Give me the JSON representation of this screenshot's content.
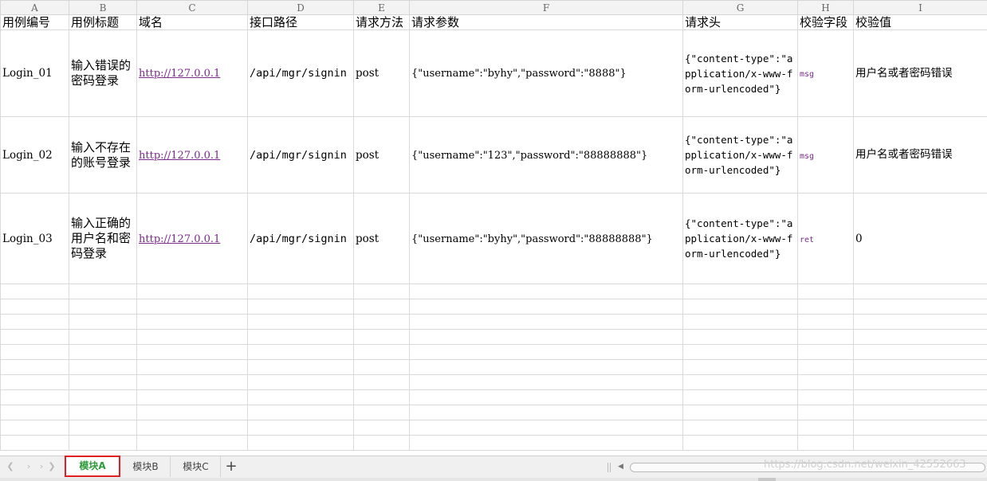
{
  "columns": [
    "A",
    "B",
    "C",
    "D",
    "E",
    "F",
    "G",
    "H",
    "I"
  ],
  "headers": [
    "用例编号",
    "用例标题",
    "域名",
    "接口路径",
    "请求方法",
    "请求参数",
    "请求头",
    "校验字段",
    "校验值"
  ],
  "rows": [
    {
      "id": "Login_01",
      "title": "输入错误的密码登录",
      "domain": "http://127.0.0.1",
      "path": "/api/mgr/signin",
      "method": "post",
      "params": "{\"username\":\"byhy\",\"password\":\"8888\"}",
      "headers": "{\"content-type\":\"application/x-www-form-urlencoded\"}",
      "field": "msg",
      "expected": "用户名或者密码错误"
    },
    {
      "id": "Login_02",
      "title": "输入不存在的账号登录",
      "domain": "http://127.0.0.1",
      "path": "/api/mgr/signin",
      "method": "post",
      "params": "{\"username\":\"123\",\"password\":\"88888888\"}",
      "headers": "{\"content-type\":\"application/x-www-form-urlencoded\"}",
      "field": "msg",
      "expected": "用户名或者密码错误"
    },
    {
      "id": "Login_03",
      "title": "输入正确的用户名和密码登录",
      "domain": "http://127.0.0.1",
      "path": "/api/mgr/signin",
      "method": "post",
      "params": "{\"username\":\"byhy\",\"password\":\"88888888\"}",
      "headers": "{\"content-type\":\"application/x-www-form-urlencoded\"}",
      "field": "ret",
      "expected": "0"
    }
  ],
  "sheet_tabs": {
    "active": "模块A",
    "tab_b": "模块B",
    "tab_c": "模块C",
    "add": "+"
  },
  "nav_icons": [
    "first-sheet-icon",
    "prev-sheet-icon",
    "next-sheet-icon",
    "last-sheet-icon"
  ],
  "watermark": "https://blog.csdn.net/weixin_42552663",
  "colors": {
    "active_tab_text": "#2e9b3a",
    "active_tab_border": "#e02020",
    "link": "#7a2a8a"
  }
}
